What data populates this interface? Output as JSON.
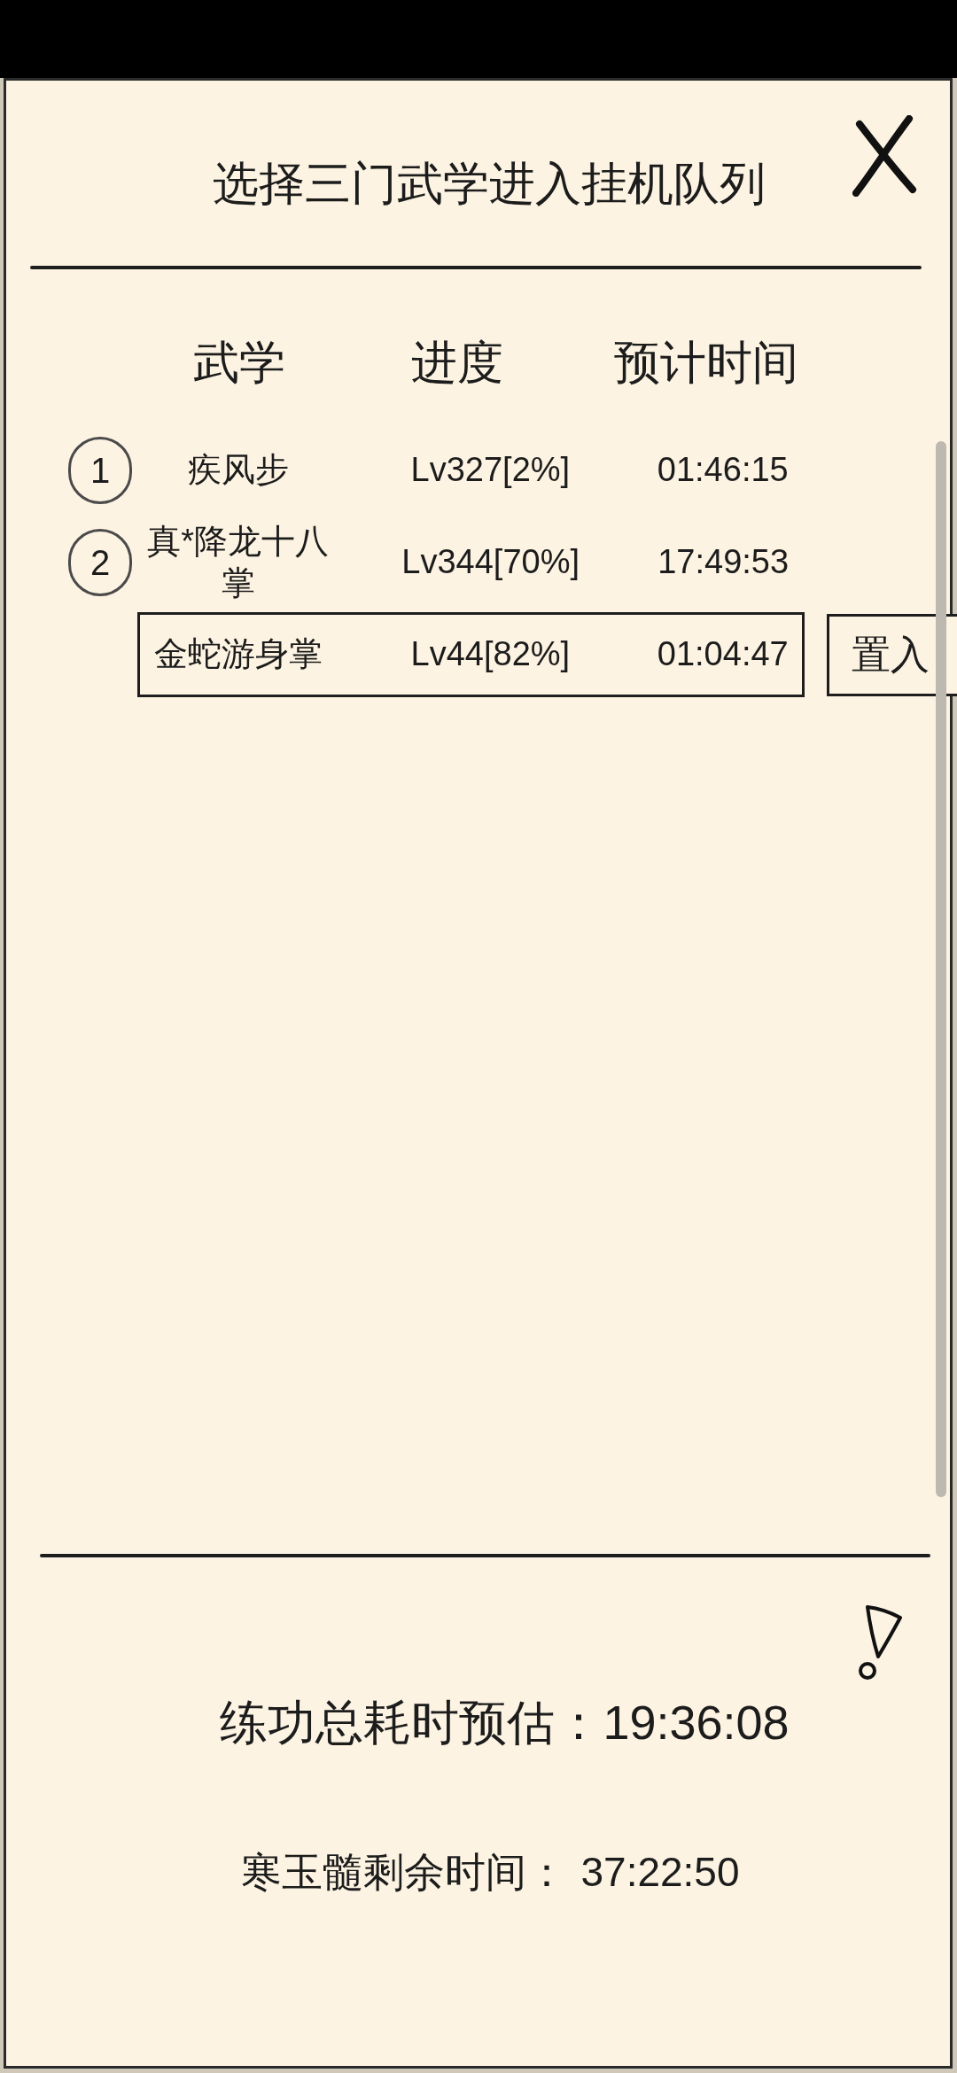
{
  "dialog": {
    "title": "选择三门武学进入挂机队列"
  },
  "table": {
    "columns": [
      "武学",
      "进度",
      "预计时间"
    ],
    "rows": [
      {
        "queue_number": "1",
        "name": "疾风步",
        "progress": "Lv327[2%]",
        "time": "01:46:15",
        "selected": false
      },
      {
        "queue_number": "2",
        "name": "真*降龙十八掌",
        "progress": "Lv344[70%]",
        "time": "17:49:53",
        "selected": false
      },
      {
        "name": "金蛇游身掌",
        "progress": "Lv44[82%]",
        "time": "01:04:47",
        "selected": true,
        "action": "置入"
      }
    ]
  },
  "summary": {
    "estimate": {
      "label": "练功总耗时预估：",
      "value": "19:36:08"
    },
    "remaining": {
      "label": "寒玉髓剩余时间：",
      "value": "37:22:50"
    }
  }
}
